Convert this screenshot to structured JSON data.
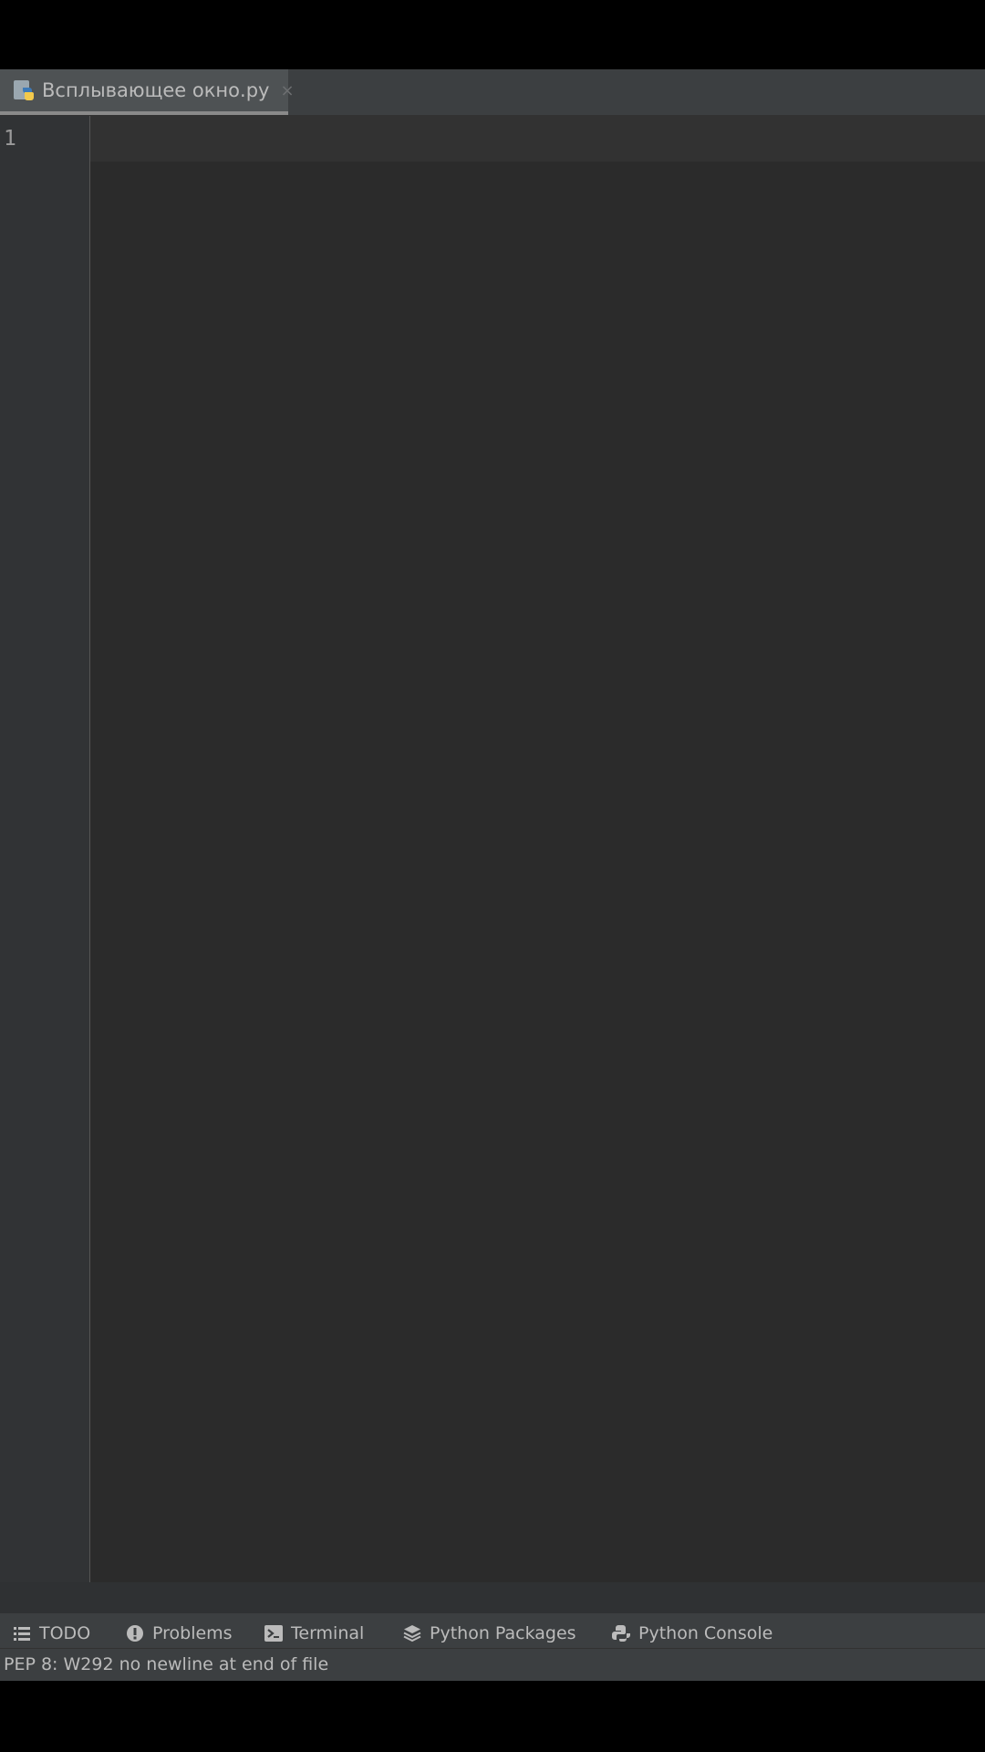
{
  "editor_tab": {
    "file_name": "Всплывающее окно.py",
    "close_glyph": "×",
    "icon": "python-file-icon"
  },
  "gutter": {
    "line_numbers": [
      "1"
    ]
  },
  "tool_windows": [
    {
      "label": "TODO",
      "icon": "list-icon"
    },
    {
      "label": "Problems",
      "icon": "warning-circle-icon"
    },
    {
      "label": "Terminal",
      "icon": "terminal-icon"
    },
    {
      "label": "Python Packages",
      "icon": "layers-icon"
    },
    {
      "label": "Python Console",
      "icon": "python-console-icon"
    }
  ],
  "status_bar": {
    "message": "PEP 8: W292 no newline at end of file"
  },
  "colors": {
    "editor_bg": "#2b2b2b",
    "gutter_bg": "#313335",
    "panel_bg": "#3c3f41",
    "text": "#bbbbbb"
  }
}
